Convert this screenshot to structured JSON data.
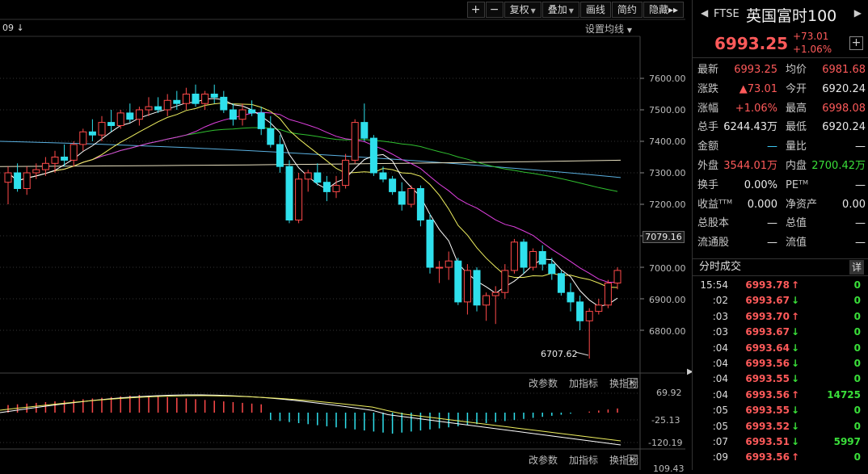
{
  "toolbar": {
    "plus": "+",
    "minus": "−",
    "fuquan": "复权",
    "diejia": "叠加",
    "huaxian": "画线",
    "jianyue": "简约",
    "yincang": "隐藏",
    "more": "▸▸"
  },
  "chart": {
    "period_label": "09 ↓",
    "ma_setting": "设置均线",
    "low_label": "6707.62",
    "current_price_tag": "7079.16",
    "price_axis": [
      "7600.00",
      "7500.00",
      "7400.00",
      "7300.00",
      "7200.00",
      "7000.00",
      "6900.00",
      "6800.00"
    ],
    "indicator1": {
      "btn1": "改参数",
      "btn2": "加指标",
      "btn3": "换指标",
      "close": "×"
    },
    "indicator2": {
      "btn1": "改参数",
      "btn2": "加指标",
      "btn3": "换指标",
      "close": "×"
    },
    "macd_axis": [
      "69.92",
      "-25.13",
      "-120.19",
      "109.43"
    ],
    "colors": {
      "up": "#ff4a4a",
      "down": "#2fe0ec",
      "ma5": "#ffffff",
      "ma10": "#f0f060",
      "ma20": "#e040e0",
      "ma60": "#30c030",
      "ma120": "#5ab0e0",
      "ma250": "#e8e0c0"
    }
  },
  "chart_data": {
    "type": "candlestick",
    "ylim": [
      6700,
      7700
    ],
    "ohlc": [
      [
        7270,
        7320,
        7200,
        7300
      ],
      [
        7300,
        7330,
        7240,
        7250
      ],
      [
        7250,
        7320,
        7230,
        7300
      ],
      [
        7300,
        7330,
        7280,
        7310
      ],
      [
        7310,
        7350,
        7290,
        7330
      ],
      [
        7330,
        7370,
        7300,
        7350
      ],
      [
        7350,
        7390,
        7320,
        7340
      ],
      [
        7340,
        7400,
        7320,
        7390
      ],
      [
        7390,
        7440,
        7370,
        7430
      ],
      [
        7430,
        7470,
        7400,
        7420
      ],
      [
        7420,
        7480,
        7400,
        7460
      ],
      [
        7460,
        7500,
        7430,
        7450
      ],
      [
        7450,
        7500,
        7440,
        7490
      ],
      [
        7490,
        7520,
        7460,
        7470
      ],
      [
        7470,
        7510,
        7450,
        7500
      ],
      [
        7500,
        7540,
        7480,
        7510
      ],
      [
        7510,
        7540,
        7490,
        7500
      ],
      [
        7500,
        7550,
        7480,
        7530
      ],
      [
        7530,
        7560,
        7500,
        7520
      ],
      [
        7520,
        7570,
        7500,
        7550
      ],
      [
        7550,
        7580,
        7510,
        7520
      ],
      [
        7520,
        7560,
        7500,
        7550
      ],
      [
        7550,
        7580,
        7520,
        7540
      ],
      [
        7540,
        7560,
        7490,
        7500
      ],
      [
        7500,
        7520,
        7450,
        7470
      ],
      [
        7470,
        7520,
        7450,
        7500
      ],
      [
        7500,
        7530,
        7480,
        7490
      ],
      [
        7490,
        7510,
        7420,
        7440
      ],
      [
        7440,
        7480,
        7380,
        7390
      ],
      [
        7390,
        7420,
        7300,
        7320
      ],
      [
        7320,
        7340,
        7140,
        7150
      ],
      [
        7150,
        7300,
        7140,
        7280
      ],
      [
        7280,
        7310,
        7240,
        7300
      ],
      [
        7300,
        7330,
        7260,
        7270
      ],
      [
        7270,
        7290,
        7210,
        7240
      ],
      [
        7240,
        7290,
        7220,
        7260
      ],
      [
        7260,
        7360,
        7250,
        7340
      ],
      [
        7340,
        7470,
        7330,
        7460
      ],
      [
        7460,
        7520,
        7400,
        7410
      ],
      [
        7410,
        7420,
        7290,
        7300
      ],
      [
        7300,
        7320,
        7270,
        7280
      ],
      [
        7280,
        7290,
        7230,
        7240
      ],
      [
        7240,
        7270,
        7180,
        7200
      ],
      [
        7200,
        7260,
        7190,
        7250
      ],
      [
        7250,
        7260,
        7130,
        7150
      ],
      [
        7150,
        7170,
        6980,
        7000
      ],
      [
        7000,
        7020,
        6950,
        7000
      ],
      [
        7000,
        7050,
        6960,
        7020
      ],
      [
        7020,
        7030,
        6880,
        6890
      ],
      [
        6890,
        7010,
        6850,
        6990
      ],
      [
        6990,
        7000,
        6860,
        6880
      ],
      [
        6880,
        6920,
        6830,
        6910
      ],
      [
        6910,
        6940,
        6820,
        6920
      ],
      [
        6920,
        7010,
        6900,
        6990
      ],
      [
        6990,
        7090,
        6980,
        7080
      ],
      [
        7080,
        7090,
        6980,
        7000
      ],
      [
        7000,
        7060,
        6990,
        7050
      ],
      [
        7050,
        7070,
        6990,
        7010
      ],
      [
        7010,
        7030,
        6960,
        6980
      ],
      [
        6980,
        6990,
        6910,
        6920
      ],
      [
        6920,
        6950,
        6860,
        6890
      ],
      [
        6890,
        6910,
        6800,
        6830
      ],
      [
        6830,
        6870,
        6710,
        6860
      ],
      [
        6860,
        6900,
        6850,
        6880
      ],
      [
        6880,
        6960,
        6870,
        6950
      ],
      [
        6950,
        7000,
        6930,
        6990
      ]
    ],
    "low_annotation": 6707.62,
    "current_price": 7079.16
  },
  "quote": {
    "code": "FTSE",
    "name": "英国富时100",
    "last": "6993.25",
    "change": "+73.01",
    "change_pct": "+1.06%",
    "add": "+",
    "rows": [
      [
        {
          "label": "最新",
          "value": "6993.25",
          "cls": "red"
        },
        {
          "label": "均价",
          "value": "6981.68",
          "cls": "red"
        }
      ],
      [
        {
          "label": "涨跌",
          "value": "▲73.01",
          "cls": "red"
        },
        {
          "label": "今开",
          "value": "6920.24",
          "cls": "white"
        }
      ],
      [
        {
          "label": "涨幅",
          "value": "+1.06%",
          "cls": "red"
        },
        {
          "label": "最高",
          "value": "6998.08",
          "cls": "red"
        }
      ],
      [
        {
          "label": "总手",
          "value": "6244.43万",
          "cls": "white"
        },
        {
          "label": "最低",
          "value": "6920.24",
          "cls": "white"
        }
      ],
      [
        {
          "label": "金额",
          "value": "—",
          "cls": "cyan"
        },
        {
          "label": "量比",
          "value": "—",
          "cls": "white"
        }
      ],
      [
        {
          "label": "外盘",
          "value": "3544.01万",
          "cls": "red"
        },
        {
          "label": "内盘",
          "value": "2700.42万",
          "cls": "green"
        }
      ],
      [
        {
          "label": "换手",
          "value": "0.00%",
          "cls": "white"
        },
        {
          "label": "PEᵀᴹ",
          "value": "—",
          "cls": "white"
        }
      ],
      [
        {
          "label": "收益ᵀᵀᴹ",
          "value": "0.000",
          "cls": "white"
        },
        {
          "label": "净资产",
          "value": "0.00",
          "cls": "white"
        }
      ],
      [
        {
          "label": "总股本",
          "value": "—",
          "cls": "white"
        },
        {
          "label": "总值",
          "value": "—",
          "cls": "white"
        }
      ],
      [
        {
          "label": "流通股",
          "value": "—",
          "cls": "white"
        },
        {
          "label": "流值",
          "value": "—",
          "cls": "white"
        }
      ]
    ],
    "tick_title": "分时成交",
    "tick_detail": "详",
    "ticks": [
      {
        "time": "15:54",
        "price": "6993.78",
        "dir": "up",
        "vol": "0"
      },
      {
        "time": ":02",
        "price": "6993.67",
        "dir": "down",
        "vol": "0"
      },
      {
        "time": ":03",
        "price": "6993.70",
        "dir": "up",
        "vol": "0"
      },
      {
        "time": ":03",
        "price": "6993.67",
        "dir": "down",
        "vol": "0"
      },
      {
        "time": ":04",
        "price": "6993.64",
        "dir": "down",
        "vol": "0"
      },
      {
        "time": ":04",
        "price": "6993.56",
        "dir": "down",
        "vol": "0"
      },
      {
        "time": ":04",
        "price": "6993.55",
        "dir": "down",
        "vol": "0"
      },
      {
        "time": ":04",
        "price": "6993.56",
        "dir": "up",
        "vol": "14725"
      },
      {
        "time": ":05",
        "price": "6993.55",
        "dir": "down",
        "vol": "0"
      },
      {
        "time": ":05",
        "price": "6993.52",
        "dir": "down",
        "vol": "0"
      },
      {
        "time": ":07",
        "price": "6993.51",
        "dir": "down",
        "vol": "5997"
      },
      {
        "time": ":09",
        "price": "6993.56",
        "dir": "up",
        "vol": "0"
      }
    ]
  }
}
